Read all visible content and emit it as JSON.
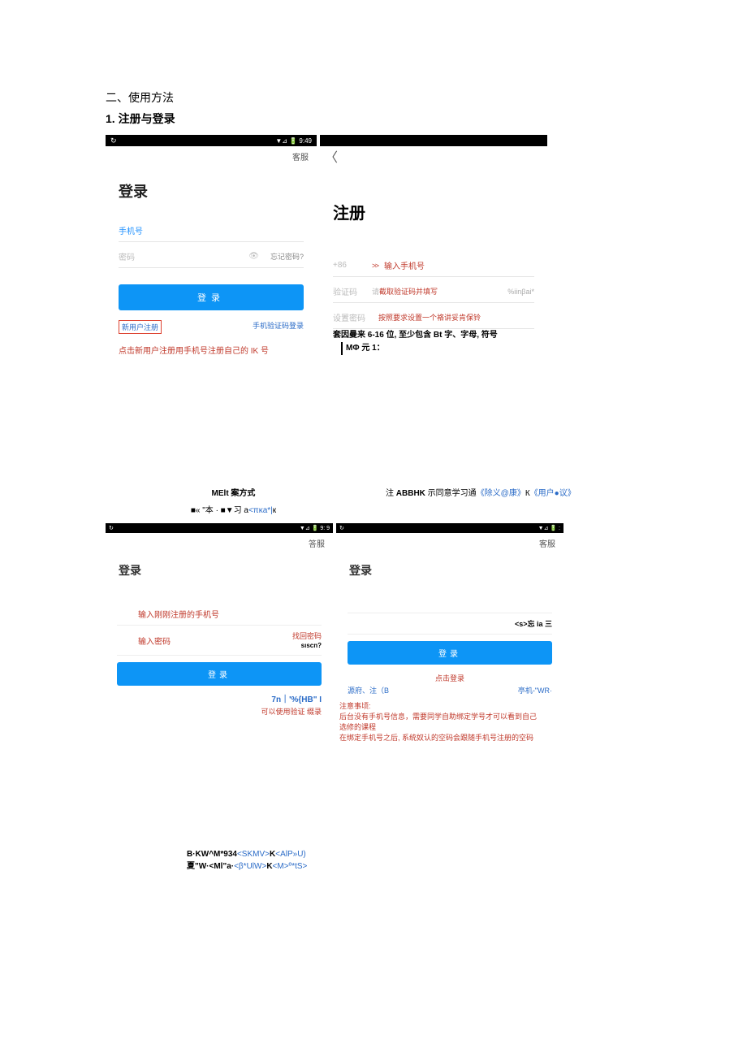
{
  "headings": {
    "h1": "二、使用方法",
    "h2": "1. 注册与登录"
  },
  "screen1": {
    "status_time": "9:49",
    "kefu": "客服",
    "title": "登录",
    "ph_phone": "手机号",
    "ph_pass": "密码",
    "forgot": "忘记密码?",
    "btn": "登录",
    "new_user": "新用户注册",
    "sms_login": "手机验证码登录",
    "caption": "点击新用户注册用手机号注册自己的 IK 号"
  },
  "screen2": {
    "back": "〈",
    "title": "注册",
    "field1_label": "+86",
    "field1_arrows": "> >",
    "field1_annot": "输入手机号",
    "field2_label": "验证码",
    "field2_ph": "请",
    "field2_annot": "截取验证码并填写",
    "field2_right": "%iinβai*",
    "field3_label": "设置密码",
    "field3_annot": "按照要求设置一个袼讲妥肯保铃",
    "hint_line1": "套因曼来 6-16 位, 至少包含 Bt 字、字母, 符号",
    "hint_line2": "MΦ 元 1："
  },
  "mid": {
    "left_title": "MElt 案方式",
    "left_sub_pre": "■« \"本 · ■▼习 a",
    "left_sub_link": "<πκa*|",
    "left_sub_tail": "к",
    "right_pre": "注 ",
    "right_bold": "ABBHK",
    "right_text": " 示同意学习通",
    "right_link1": "《除义@康》",
    "right_k": "К",
    "right_link2": "《用户●议》"
  },
  "screen3": {
    "status_time": "9: 9",
    "kefu": "答服",
    "title": "登录",
    "annot_phone": "输入刚刚注册的手机号",
    "annot_pass": "输入密码",
    "forgot_label": "找回密码",
    "forgot_sub": "sıscn?",
    "btn": "登录",
    "bottom_right": "7n｜'%{HB\" I",
    "bottom_annot": "可以使用验证  缀录"
  },
  "screen4": {
    "kefu": "客服",
    "title": "登录",
    "forgot": "<s>忘 ia 三",
    "btn": "登录",
    "click_login": "点击登录",
    "bl_left": "源府、注（B",
    "bl_right": "亭机-\"WR·",
    "note_title": "注意事顷:",
    "note_line1": "后台没有手机号信息，需要同学自助绑定学号才可以看到自己",
    "note_line2": "选修的课程",
    "note_line3": "在绑定手机号之后, 系统奴认的空码会跟随手机号注册的空码"
  },
  "footer": {
    "l1_a": "B·KW^M*934",
    "l1_b": "<SKMV>",
    "l1_c": "K",
    "l1_d": "<AlP»U)",
    "l2_a": "夏\"W·<Ml\"a·",
    "l2_b": "<β*UlW>",
    "l2_c": "K",
    "l2_d": "<M>º*tS>"
  }
}
